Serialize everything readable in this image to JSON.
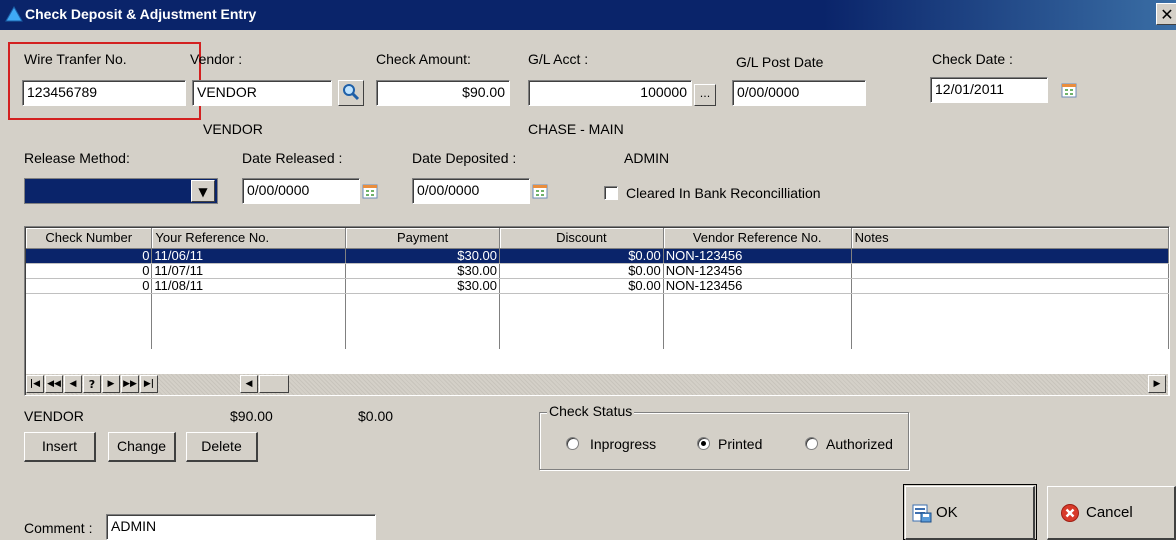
{
  "window": {
    "title": "Check Deposit & Adjustment Entry",
    "close_glyph": "✕"
  },
  "header": {
    "wire_transfer_label": "Wire Tranfer No.",
    "wire_transfer_value": "123456789",
    "vendor_label": "Vendor :",
    "vendor_value": "VENDOR",
    "vendor_name": "VENDOR",
    "check_amount_label": "Check Amount:",
    "check_amount_value": "$90.00",
    "gl_acct_label": "G/L Acct :",
    "gl_acct_value": "100000",
    "gl_acct_button": "...",
    "gl_acct_name": "CHASE - MAIN",
    "gl_post_date_label": "G/L Post Date",
    "gl_post_date_value": "0/00/0000",
    "check_date_label": "Check Date :",
    "check_date_value": "12/01/2011"
  },
  "release": {
    "release_method_label": "Release Method:",
    "release_method_value": "",
    "date_released_label": "Date Released :",
    "date_released_value": "0/00/0000",
    "date_deposited_label": "Date Deposited :",
    "date_deposited_value": "0/00/0000",
    "admin_text": "ADMIN",
    "cleared_label": "Cleared In Bank Reconcilliation",
    "cleared_checked": false
  },
  "grid": {
    "columns": [
      "Check Number",
      "Your Reference No.",
      "Payment",
      "Discount",
      "Vendor Reference No.",
      "Notes"
    ],
    "rows": [
      {
        "check_number": "0",
        "reference": "11/06/11",
        "payment": "$30.00",
        "discount": "$0.00",
        "vendor_ref": "NON-123456",
        "notes": "",
        "selected": true
      },
      {
        "check_number": "0",
        "reference": "11/07/11",
        "payment": "$30.00",
        "discount": "$0.00",
        "vendor_ref": "NON-123456",
        "notes": "",
        "selected": false
      },
      {
        "check_number": "0",
        "reference": "11/08/11",
        "payment": "$30.00",
        "discount": "$0.00",
        "vendor_ref": "NON-123456",
        "notes": "",
        "selected": false
      }
    ],
    "nav_buttons": [
      "first",
      "prev-page",
      "prev",
      "?",
      "next",
      "next-page",
      "last"
    ]
  },
  "totals": {
    "vendor": "VENDOR",
    "payment_total": "$90.00",
    "discount_total": "$0.00"
  },
  "actions": {
    "insert_label": "Insert",
    "change_label": "Change",
    "delete_label": "Delete"
  },
  "check_status": {
    "legend": "Check Status",
    "options": [
      {
        "label": "Inprogress",
        "selected": false
      },
      {
        "label": "Printed",
        "selected": true
      },
      {
        "label": "Authorized",
        "selected": false
      }
    ]
  },
  "footer": {
    "comment_label": "Comment :",
    "comment_value": "ADMIN",
    "ok_label": "OK",
    "cancel_label": "Cancel"
  },
  "colors": {
    "title_bar": "#0a246a",
    "selection": "#0a246a",
    "dialog_bg": "#d4d0c8",
    "highlight_box": "#d32020",
    "cancel_icon": "#d83a2a"
  }
}
